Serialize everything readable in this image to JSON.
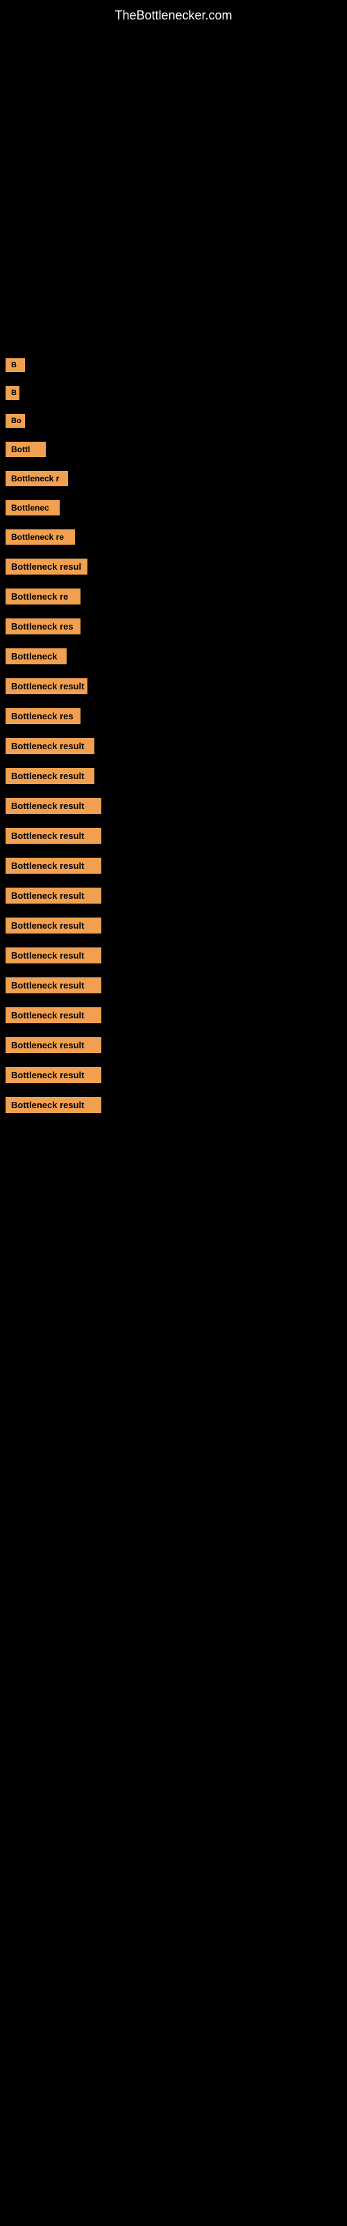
{
  "site": {
    "title": "TheBottlenecker.com"
  },
  "items": [
    {
      "id": 1,
      "label": "B"
    },
    {
      "id": 2,
      "label": "B"
    },
    {
      "id": 3,
      "label": "Bo"
    },
    {
      "id": 4,
      "label": "Bottl"
    },
    {
      "id": 5,
      "label": "Bottleneck r"
    },
    {
      "id": 6,
      "label": "Bottlenec"
    },
    {
      "id": 7,
      "label": "Bottleneck re"
    },
    {
      "id": 8,
      "label": "Bottleneck resul"
    },
    {
      "id": 9,
      "label": "Bottleneck re"
    },
    {
      "id": 10,
      "label": "Bottleneck res"
    },
    {
      "id": 11,
      "label": "Bottleneck"
    },
    {
      "id": 12,
      "label": "Bottleneck result"
    },
    {
      "id": 13,
      "label": "Bottleneck res"
    },
    {
      "id": 14,
      "label": "Bottleneck result"
    },
    {
      "id": 15,
      "label": "Bottleneck result"
    },
    {
      "id": 16,
      "label": "Bottleneck result"
    },
    {
      "id": 17,
      "label": "Bottleneck result"
    },
    {
      "id": 18,
      "label": "Bottleneck result"
    },
    {
      "id": 19,
      "label": "Bottleneck result"
    },
    {
      "id": 20,
      "label": "Bottleneck result"
    },
    {
      "id": 21,
      "label": "Bottleneck result"
    },
    {
      "id": 22,
      "label": "Bottleneck result"
    },
    {
      "id": 23,
      "label": "Bottleneck result"
    },
    {
      "id": 24,
      "label": "Bottleneck result"
    },
    {
      "id": 25,
      "label": "Bottleneck result"
    },
    {
      "id": 26,
      "label": "Bottleneck result"
    }
  ]
}
